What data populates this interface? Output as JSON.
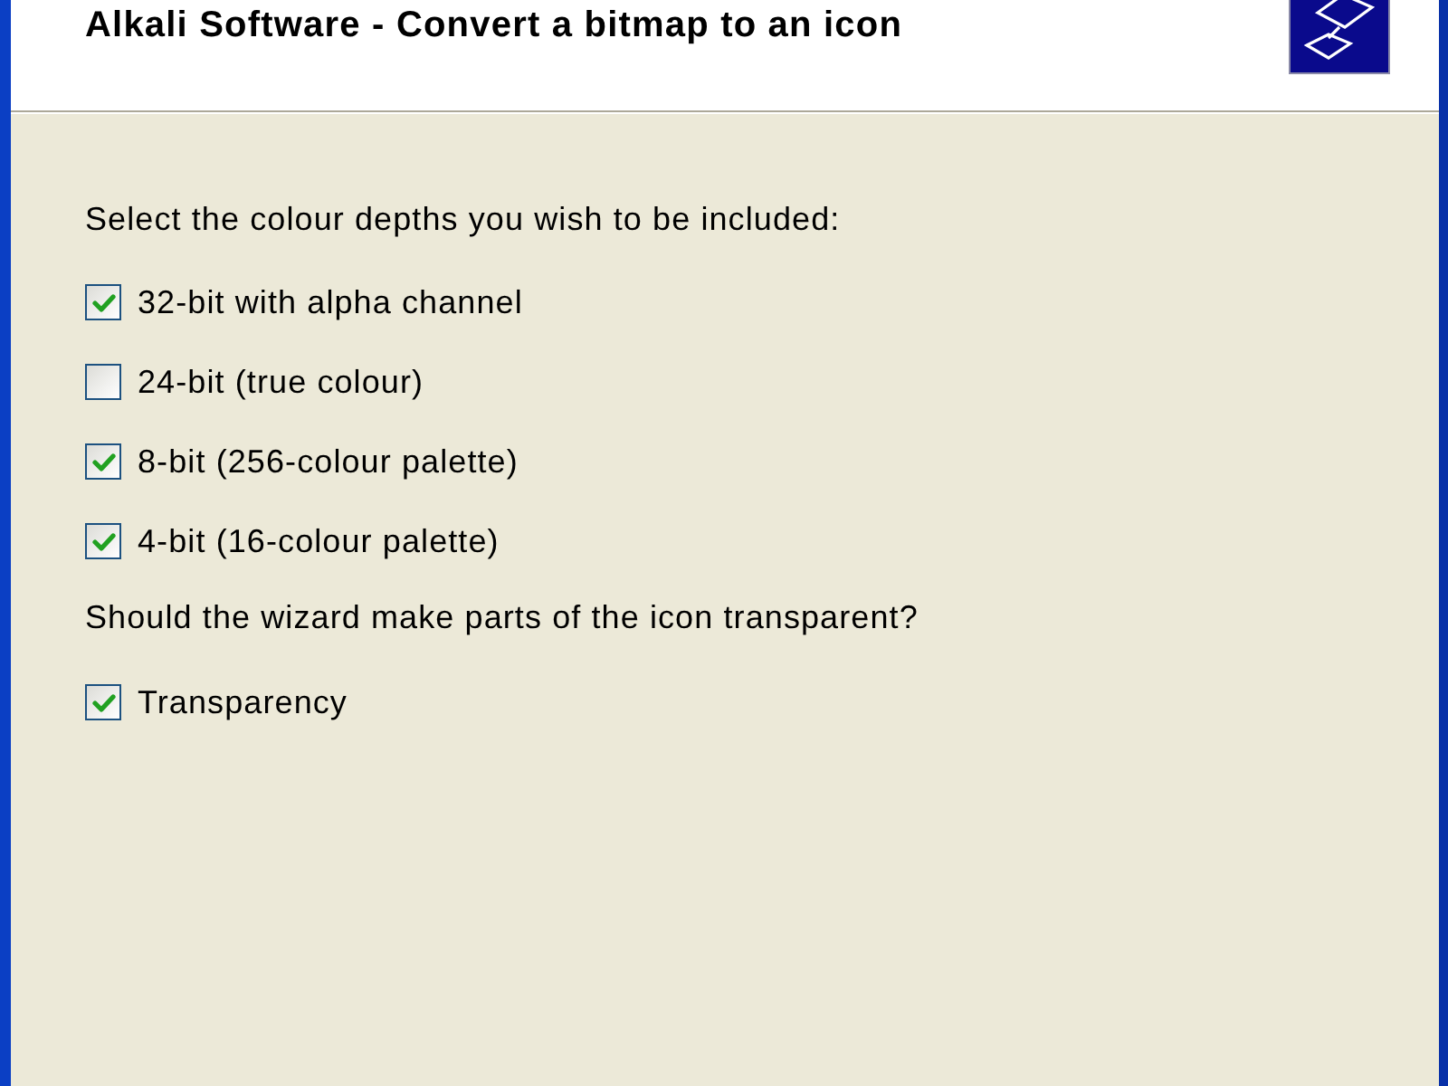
{
  "header": {
    "title": "Alkali Software - Convert a bitmap to an icon"
  },
  "colour_depths": {
    "prompt": "Select the colour depths you wish to be included:",
    "options": [
      {
        "label": "32-bit with alpha channel",
        "checked": true
      },
      {
        "label": "24-bit (true colour)",
        "checked": false
      },
      {
        "label": "8-bit (256-colour palette)",
        "checked": true
      },
      {
        "label": "4-bit (16-colour palette)",
        "checked": true
      }
    ]
  },
  "transparency": {
    "prompt": "Should the wizard make parts of the icon transparent?",
    "options": [
      {
        "label": "Transparency",
        "checked": true
      }
    ]
  }
}
